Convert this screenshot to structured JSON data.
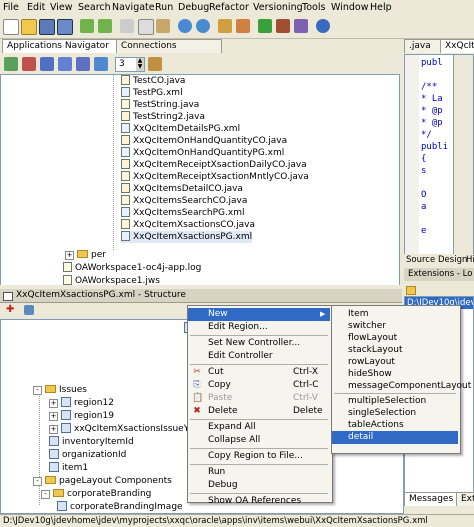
{
  "menubar": [
    "File",
    "Edit",
    "View",
    "Search",
    "Navigate",
    "Run",
    "Debug",
    "Refactor",
    "Versioning",
    "Tools",
    "Window",
    "Help"
  ],
  "navigator": {
    "tabs": [
      "Applications Navigator",
      "Connections Navigator"
    ],
    "spinner_value": "3",
    "filter_text": "",
    "files": [
      {
        "name": "TestCO.java",
        "type": "java"
      },
      {
        "name": "TestPG.xml",
        "type": "xml"
      },
      {
        "name": "TestString.java",
        "type": "java"
      },
      {
        "name": "TestString2.java",
        "type": "java"
      },
      {
        "name": "XxQcItemDetailsPG.xml",
        "type": "xml"
      },
      {
        "name": "XxQcItemOnHandQuantityCO.java",
        "type": "java"
      },
      {
        "name": "XxQcItemOnHandQuantityPG.xml",
        "type": "xml"
      },
      {
        "name": "XxQcItemReceiptXsactionDailyCO.java",
        "type": "java"
      },
      {
        "name": "XxQcItemReceiptXsactionMntlyCO.java",
        "type": "java"
      },
      {
        "name": "XxQcItemsDetailCO.java",
        "type": "java"
      },
      {
        "name": "XxQcItemsSearchCO.java",
        "type": "java"
      },
      {
        "name": "XxQcItemsSearchPG.xml",
        "type": "xml"
      },
      {
        "name": "XxQcItemXsactionsCO.java",
        "type": "java"
      },
      {
        "name": "XxQcItemXsactionsPG.xml",
        "type": "xml"
      }
    ],
    "per_folder": "per",
    "log_file": "OAWorkspace1-oc4j-app.log",
    "workspace_file": "OAWorkspace1.jws"
  },
  "editor": {
    "tabs": [
      ".java",
      "XxQcIte"
    ],
    "code_lines": [
      "publ",
      "",
      "/**",
      "* La",
      "* @p",
      "* @p",
      "*/",
      "publi",
      "{",
      "s",
      "",
      "O",
      "a",
      "",
      "e"
    ],
    "bottom_tabs": [
      "Source",
      "Design",
      "Hi"
    ]
  },
  "structure": {
    "title": "XxQcItemXsactionsPG.xml - Structure",
    "nodes": [
      {
        "label": "Issues",
        "kind": "folder",
        "expander": "-"
      },
      {
        "label": "region12",
        "kind": "region",
        "expander": "+"
      },
      {
        "label": "region19",
        "kind": "region",
        "expander": "+"
      },
      {
        "label": "xxQcItemXsactionsIssueYrlyVO",
        "kind": "table",
        "expander": "+"
      },
      {
        "label": "inventoryItemId",
        "kind": "region",
        "expander": ""
      },
      {
        "label": "organizationId",
        "kind": "region",
        "expander": ""
      },
      {
        "label": "item1",
        "kind": "region",
        "expander": ""
      },
      {
        "label": "pageLayout Components",
        "kind": "folder",
        "expander": "-"
      },
      {
        "label": "corporateBranding",
        "kind": "folder",
        "expander": "-"
      },
      {
        "label": "corporateBrandingImage",
        "kind": "region",
        "expander": ""
      }
    ]
  },
  "context_menu": {
    "items": [
      {
        "label": "New",
        "shortcut": "",
        "icon": "",
        "submenu": true,
        "highlighted": true,
        "disabled": false
      },
      {
        "label": "Edit Region...",
        "shortcut": "",
        "icon": "",
        "submenu": false,
        "highlighted": false,
        "disabled": false
      },
      {
        "sep": true
      },
      {
        "label": "Set New Controller...",
        "shortcut": "",
        "icon": "",
        "submenu": false,
        "highlighted": false,
        "disabled": false
      },
      {
        "label": "Edit Controller",
        "shortcut": "",
        "icon": "",
        "submenu": false,
        "highlighted": false,
        "disabled": false
      },
      {
        "sep": true
      },
      {
        "label": "Cut",
        "shortcut": "Ctrl-X",
        "icon": "✂",
        "submenu": false,
        "highlighted": false,
        "disabled": false
      },
      {
        "label": "Copy",
        "shortcut": "Ctrl-C",
        "icon": "⎘",
        "submenu": false,
        "highlighted": false,
        "disabled": false
      },
      {
        "label": "Paste",
        "shortcut": "Ctrl-V",
        "icon": "📋",
        "submenu": false,
        "highlighted": false,
        "disabled": true
      },
      {
        "label": "Delete",
        "shortcut": "Delete",
        "icon": "✖",
        "submenu": false,
        "highlighted": false,
        "disabled": false
      },
      {
        "sep": true
      },
      {
        "label": "Expand All",
        "shortcut": "",
        "icon": "",
        "submenu": false,
        "highlighted": false,
        "disabled": false
      },
      {
        "label": "Collapse All",
        "shortcut": "",
        "icon": "",
        "submenu": false,
        "highlighted": false,
        "disabled": false
      },
      {
        "sep": true
      },
      {
        "label": "Copy Region to File...",
        "shortcut": "",
        "icon": "",
        "submenu": false,
        "highlighted": false,
        "disabled": false
      },
      {
        "sep": true
      },
      {
        "label": "Run",
        "shortcut": "",
        "icon": "",
        "submenu": false,
        "highlighted": false,
        "disabled": false
      },
      {
        "label": "Debug",
        "shortcut": "",
        "icon": "",
        "submenu": false,
        "highlighted": false,
        "disabled": false
      },
      {
        "sep": true
      },
      {
        "label": "Show OA References",
        "shortcut": "",
        "icon": "",
        "submenu": false,
        "highlighted": false,
        "disabled": false
      }
    ]
  },
  "submenu": {
    "items": [
      {
        "label": "Item",
        "highlighted": false
      },
      {
        "label": "switcher",
        "highlighted": false
      },
      {
        "label": "flowLayout",
        "highlighted": false
      },
      {
        "label": "stackLayout",
        "highlighted": false
      },
      {
        "label": "rowLayout",
        "highlighted": false
      },
      {
        "label": "hideShow",
        "highlighted": false
      },
      {
        "label": "messageComponentLayout",
        "highlighted": false
      },
      {
        "sep": true
      },
      {
        "label": "multipleSelection",
        "highlighted": false
      },
      {
        "label": "singleSelection",
        "highlighted": false
      },
      {
        "label": "tableActions",
        "highlighted": false
      },
      {
        "label": "detail",
        "highlighted": true
      }
    ]
  },
  "right_lower": {
    "tab": "Extensions - Lo",
    "path": "D:\\JDev10g\\jdev",
    "bottom_tabs": [
      "Messages",
      "Exte"
    ]
  },
  "colors": {
    "highlight": "#316ac5",
    "chrome": "#ece9d8"
  },
  "statusbar": {
    "path": "D:\\JDev10g\\jdevhome\\jdev\\myprojects\\xxqc\\oracle\\apps\\inv\\items\\webui\\XxQcItemXsactionsPG.xml"
  }
}
